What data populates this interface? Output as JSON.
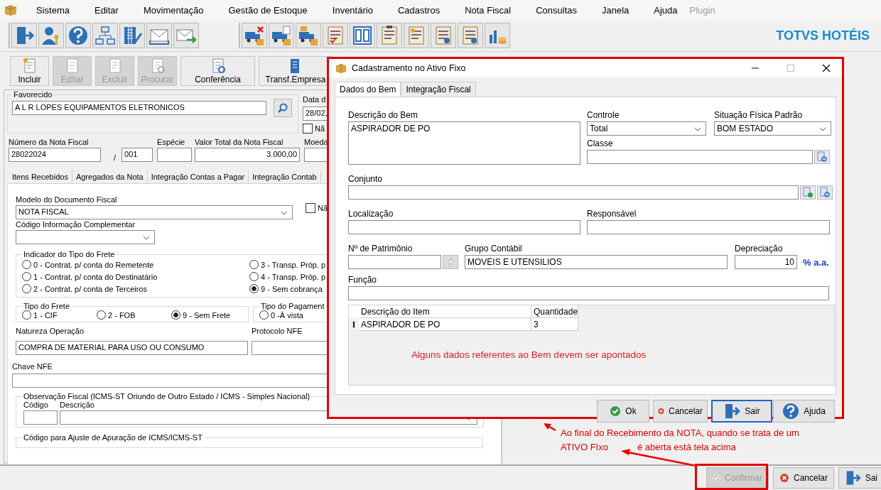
{
  "menu": [
    {
      "label": "Sistema",
      "disabled": false
    },
    {
      "label": "Editar",
      "disabled": false
    },
    {
      "label": "Movimentação",
      "disabled": false
    },
    {
      "label": "Gestão de Estoque",
      "disabled": false
    },
    {
      "label": "Inventário",
      "disabled": false
    },
    {
      "label": "Cadastros",
      "disabled": false
    },
    {
      "label": "Nota Fiscal",
      "disabled": false
    },
    {
      "label": "Consultas",
      "disabled": false
    },
    {
      "label": "Janela",
      "disabled": false
    },
    {
      "label": "Ajuda",
      "disabled": false
    },
    {
      "label": "Plugin",
      "disabled": true
    }
  ],
  "brand": "TOTVS HOTÉIS",
  "actions": [
    {
      "label": "Incluir",
      "disabled": false
    },
    {
      "label": "Editar",
      "disabled": true
    },
    {
      "label": "Excluir",
      "disabled": true
    },
    {
      "label": "Procurar",
      "disabled": true
    },
    {
      "label": "Conferência",
      "disabled": false
    },
    {
      "label": "Transf.Empresa",
      "disabled": false
    }
  ],
  "form": {
    "favorecido": {
      "label": "Favorecido",
      "value": "A L R LOPES EQUIPAMENTOS ELETRONICOS"
    },
    "data": {
      "label": "Data d",
      "value": "28/02,"
    },
    "nao": {
      "label": "Nã",
      "checked": false
    },
    "numero": {
      "label": "Número da Nota Fiscal",
      "value": "28022024"
    },
    "serie": {
      "separator": "/",
      "value": "001"
    },
    "especie": {
      "label": "Espécie"
    },
    "valor": {
      "label": "Valor Total da Nota Fiscal",
      "value": "3.000,00"
    },
    "moeda": {
      "label": "Moeda"
    }
  },
  "tabs": [
    {
      "label": "Itens Recebidos",
      "selected": false
    },
    {
      "label": "Agregados da Nota",
      "selected": false
    },
    {
      "label": "Integração Contas a Pagar",
      "selected": false
    },
    {
      "label": "Integração Contab",
      "selected": false
    }
  ],
  "panel": {
    "modelo": {
      "label": "Modelo do Documento Fiscal",
      "value": "NOTA FISCAL"
    },
    "nao": {
      "label": "Nã",
      "checked": false
    },
    "codigo_info": {
      "label": "Código Informação Complementar"
    },
    "indicador": {
      "legend": "Indicador do Tipo do Frete",
      "options": [
        {
          "label": "0 - Contrat. p/ conta do Remetente",
          "selected": false
        },
        {
          "label": "1 - Contrat. p/ conta do Destinatário",
          "selected": false
        },
        {
          "label": "2 - Contrat. p/ conta de Terceiros",
          "selected": false
        },
        {
          "label": "3 - Transp. Próp. p",
          "selected": false
        },
        {
          "label": "4 - Transp. Próp. p",
          "selected": false
        },
        {
          "label": "9 - Sem cobrança",
          "selected": true
        }
      ]
    },
    "tipo_frete": {
      "legend": "Tipo do Frete",
      "options": [
        {
          "label": "1 - CIF",
          "selected": false
        },
        {
          "label": "2 - FOB",
          "selected": false
        },
        {
          "label": "9 - Sem Frete",
          "selected": true
        }
      ]
    },
    "tipo_pagamento": {
      "legend": "Tipo do Pagament",
      "options": [
        {
          "label": "0 -À vista",
          "selected": false
        }
      ]
    },
    "natureza": {
      "label": "Natureza Operação",
      "value": "COMPRA DE MATERIAL PARA USO OU CONSUMO"
    },
    "protocolo": {
      "label": "Protocolo NFE"
    },
    "chave": {
      "label": "Chave NFE"
    },
    "observacao": {
      "legend": "Observação Fiscal (ICMS-ST Oriundo de Outro Estado / ICMS - Simples Nacional)",
      "codigo": "Código",
      "descricao": "Descrição"
    },
    "ajuste": {
      "legend": "Código para Ajuste de Apuração de ICMS/ICMS-ST"
    }
  },
  "bottom_buttons": [
    {
      "label": "Confirmar",
      "kind": "confirm",
      "disabled": true
    },
    {
      "label": "Cancelar",
      "kind": "cancel",
      "disabled": false
    },
    {
      "label": "Sai",
      "kind": "exit",
      "disabled": false
    }
  ],
  "dialog": {
    "title": "Cadastramento no Ativo Fixo",
    "tabs": [
      {
        "label": "Dados do Bem",
        "selected": true
      },
      {
        "label": "Integração Fiscal",
        "selected": false
      }
    ],
    "descricao": {
      "label": "Descrição do Bem",
      "value": "ASPIRADOR DE PO"
    },
    "controle": {
      "label": "Controle",
      "value": "Total"
    },
    "situacao": {
      "label": "Situação Física Padrão",
      "value": "BOM ESTADO"
    },
    "classe": {
      "label": "Classe"
    },
    "conjunto": {
      "label": "Conjunto"
    },
    "localizacao": {
      "label": "Localização"
    },
    "responsavel": {
      "label": "Responsável"
    },
    "patrimonio": {
      "label": "Nº de Patrimônio"
    },
    "grupo": {
      "label": "Grupo Contábil",
      "value": "MOVEIS E UTENSILIOS"
    },
    "depreciacao": {
      "label": "Depreciação",
      "value": "10",
      "unit": "% a.a."
    },
    "funcao": {
      "label": "Função"
    },
    "grid": {
      "columns": [
        "Descrição do Item",
        "Quantidade"
      ],
      "rows": [
        {
          "marker": "I",
          "cells": [
            "ASPIRADOR DE PO",
            "3"
          ]
        }
      ]
    },
    "note": "Alguns dados referentes ao Bem devem ser apontados",
    "buttons": [
      {
        "label": "Ok",
        "kind": "ok",
        "focused": false
      },
      {
        "label": "Cancelar",
        "kind": "cancel",
        "focused": false
      },
      {
        "label": "Sair",
        "kind": "exit",
        "focused": true
      },
      {
        "label": "Ajuda",
        "kind": "help",
        "focused": false
      }
    ]
  },
  "annotation": {
    "line1": "Ao final do Recebimento da NOTA, quando se trata de um",
    "line2a": "ATIVO FIxo",
    "line2b": "é aberta está tela acima"
  }
}
